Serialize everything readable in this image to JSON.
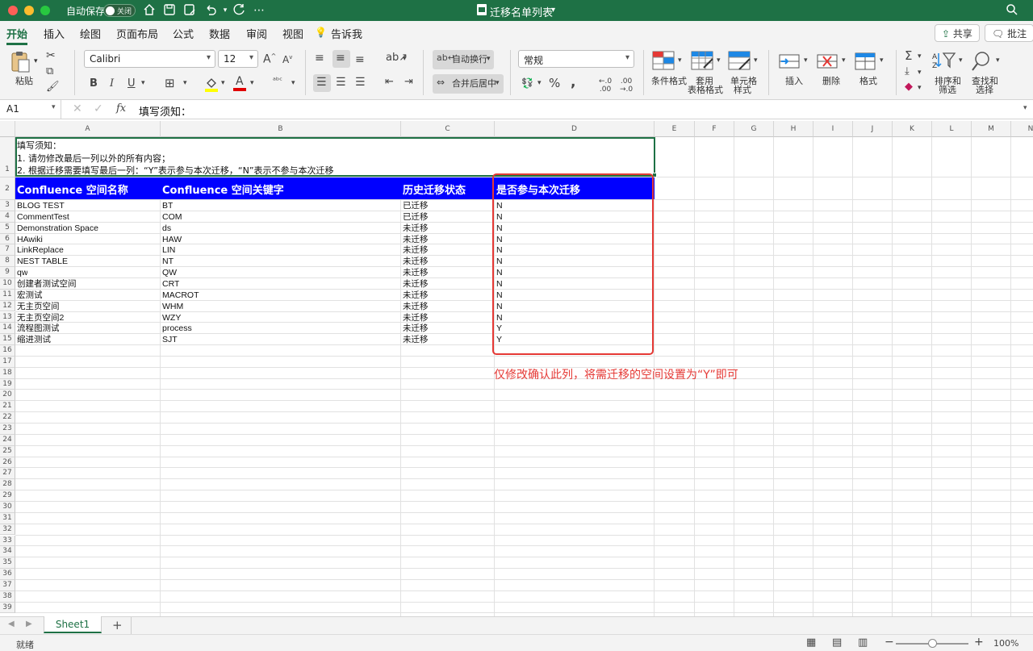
{
  "titlebar": {
    "autosave_label": "自动保存",
    "autosave_state": "关闭",
    "doc_title": "迁移名单列表",
    "colors": {
      "bar": "#1e7145",
      "close": "#ff5f57",
      "min": "#febc2e",
      "max": "#28c840"
    }
  },
  "tabs": {
    "items": [
      "开始",
      "插入",
      "绘图",
      "页面布局",
      "公式",
      "数据",
      "审阅",
      "视图",
      "告诉我"
    ],
    "share_label": "共享",
    "comment_label": "批注"
  },
  "ribbon": {
    "paste_label": "粘贴",
    "font_name": "Calibri",
    "font_size": "12",
    "wrap_label": "自动换行",
    "merge_label": "合并后居中",
    "number_format": "常规",
    "cond_format_label": "条件格式",
    "table_format_label_1": "套用",
    "table_format_label_2": "表格格式",
    "cell_style_label_1": "单元格",
    "cell_style_label_2": "样式",
    "insert_label": "插入",
    "delete_label": "删除",
    "format_label": "格式",
    "sort_label_1": "排序和",
    "sort_label_2": "筛选",
    "find_label_1": "查找和",
    "find_label_2": "选择"
  },
  "formula_bar": {
    "name_box": "A1",
    "fx": "fx",
    "value": "填写须知："
  },
  "columns": [
    "A",
    "B",
    "C",
    "D",
    "E",
    "F",
    "G",
    "H",
    "I",
    "J",
    "K",
    "L",
    "M",
    "N"
  ],
  "instructions": [
    "填写须知：",
    "1. 请勿修改最后一列以外的所有内容；",
    "2. 根据迁移需要填写最后一列：“Y”表示参与本次迁移，“N”表示不参与本次迁移"
  ],
  "table": {
    "headers": [
      "Confluence 空间名称",
      "Confluence 空间关键字",
      "历史迁移状态",
      "是否参与本次迁移"
    ],
    "header_bg": "#0000ff",
    "rows": [
      [
        "BLOG TEST",
        "BT",
        "已迁移",
        "N"
      ],
      [
        "CommentTest",
        "COM",
        "已迁移",
        "N"
      ],
      [
        "Demonstration Space",
        "ds",
        "未迁移",
        "N"
      ],
      [
        "HAwiki",
        "HAW",
        "未迁移",
        "N"
      ],
      [
        "LinkReplace",
        "LIN",
        "未迁移",
        "N"
      ],
      [
        "NEST TABLE",
        "NT",
        "未迁移",
        "N"
      ],
      [
        "qw",
        "QW",
        "未迁移",
        "N"
      ],
      [
        "创建者测试空间",
        "CRT",
        "未迁移",
        "N"
      ],
      [
        "宏测试",
        "MACROT",
        "未迁移",
        "N"
      ],
      [
        "无主页空间",
        "WHM",
        "未迁移",
        "N"
      ],
      [
        "无主页空间2",
        "WZY",
        "未迁移",
        "N"
      ],
      [
        "流程图测试",
        "process",
        "未迁移",
        "Y"
      ],
      [
        "缩进测试",
        "SJT",
        "未迁移",
        "Y"
      ]
    ]
  },
  "row_numbers": [
    "1",
    "2",
    "3",
    "4",
    "5",
    "6",
    "7",
    "8",
    "9",
    "10",
    "11",
    "12",
    "13",
    "14",
    "15",
    "16",
    "17",
    "18",
    "19",
    "20",
    "21",
    "22",
    "23",
    "24",
    "25",
    "26",
    "27",
    "28",
    "29",
    "30",
    "31",
    "32",
    "33",
    "34",
    "35",
    "36",
    "37",
    "38",
    "39"
  ],
  "annotation": {
    "text": "仅修改确认此列，将需迁移的空间设置为“Y”即可",
    "color": "#e53935"
  },
  "sheet_tabs": {
    "active": "Sheet1",
    "add": "+"
  },
  "status": {
    "ready": "就绪",
    "zoom": "100%",
    "zoom_minus": "−",
    "zoom_plus": "+"
  }
}
